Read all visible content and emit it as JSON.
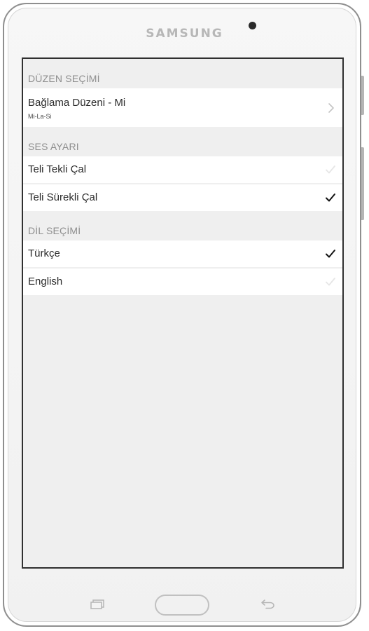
{
  "device": {
    "brand": "SAMSUNG"
  },
  "sections": {
    "tuning": {
      "header": "DÜZEN SEÇİMİ",
      "item": {
        "title": "Bağlama Düzeni - Mi",
        "subtitle": "Mi-La-Si",
        "icon": "chevron-right-icon"
      }
    },
    "sound": {
      "header": "SES AYARI",
      "items": [
        {
          "label": "Teli Tekli Çal",
          "checked": false
        },
        {
          "label": "Teli Sürekli Çal",
          "checked": true
        }
      ]
    },
    "language": {
      "header": "DİL SEÇİMİ",
      "items": [
        {
          "label": "Türkçe",
          "checked": true
        },
        {
          "label": "English",
          "checked": false
        }
      ]
    }
  },
  "colors": {
    "checked": "#111111",
    "unchecked": "#e6e6e6",
    "header_text": "#8e8e8e",
    "screen_background": "#efefef"
  },
  "nav": {
    "recent_icon": "recent-apps-icon",
    "home_button": "home-button",
    "back_icon": "back-icon"
  }
}
